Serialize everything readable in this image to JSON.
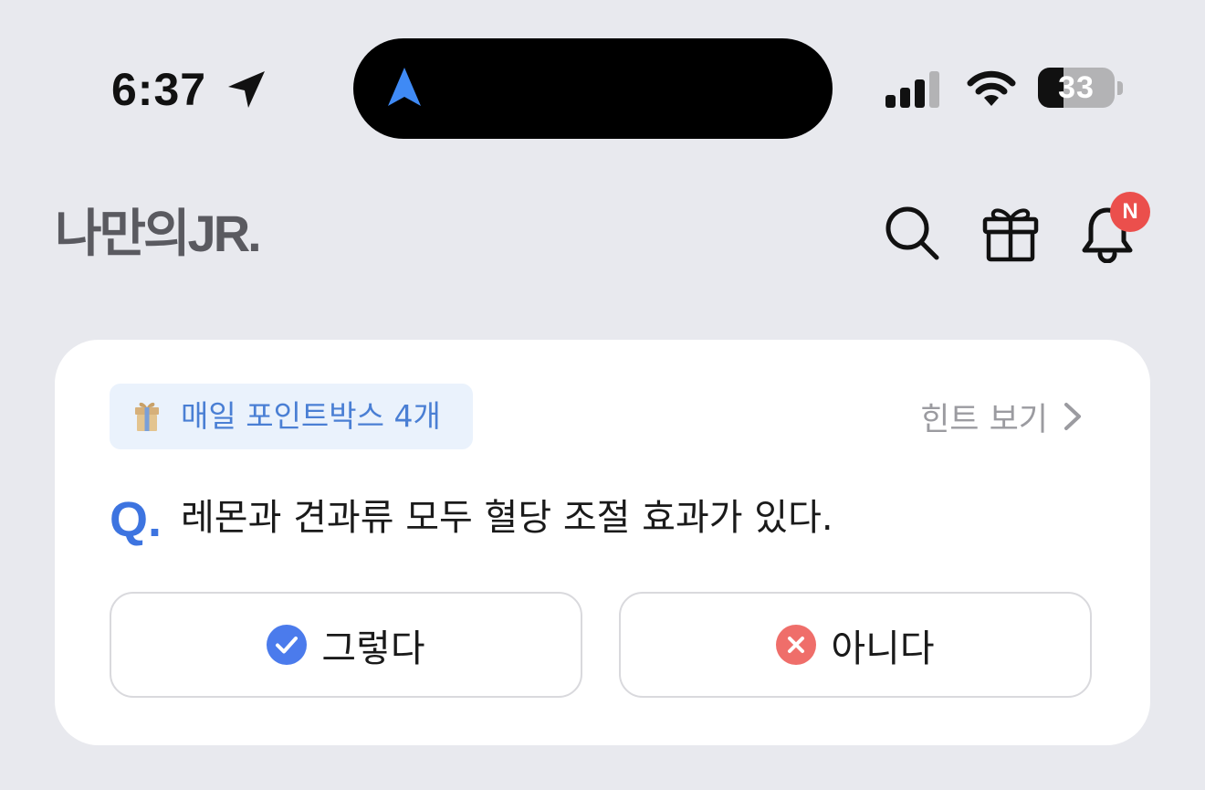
{
  "status_bar": {
    "time": "6:37",
    "battery_level": "33"
  },
  "header": {
    "logo": "나만의JR.",
    "notification_badge": "N"
  },
  "quiz": {
    "points_label": "매일 포인트박스 4개",
    "hint_label": "힌트 보기",
    "question_prefix": "Q.",
    "question": "레몬과 견과류 모두 혈당 조절 효과가 있다.",
    "answers": [
      {
        "label": "그렇다",
        "icon": "check-circle-icon",
        "color": "#4b7bec"
      },
      {
        "label": "아니다",
        "icon": "x-circle-icon",
        "color": "#ef6e6a"
      }
    ]
  },
  "colors": {
    "background": "#e8e9ee",
    "accent": "#3d74e0",
    "pill_background": "#eaf2fc",
    "badge": "#eb4f4c"
  }
}
